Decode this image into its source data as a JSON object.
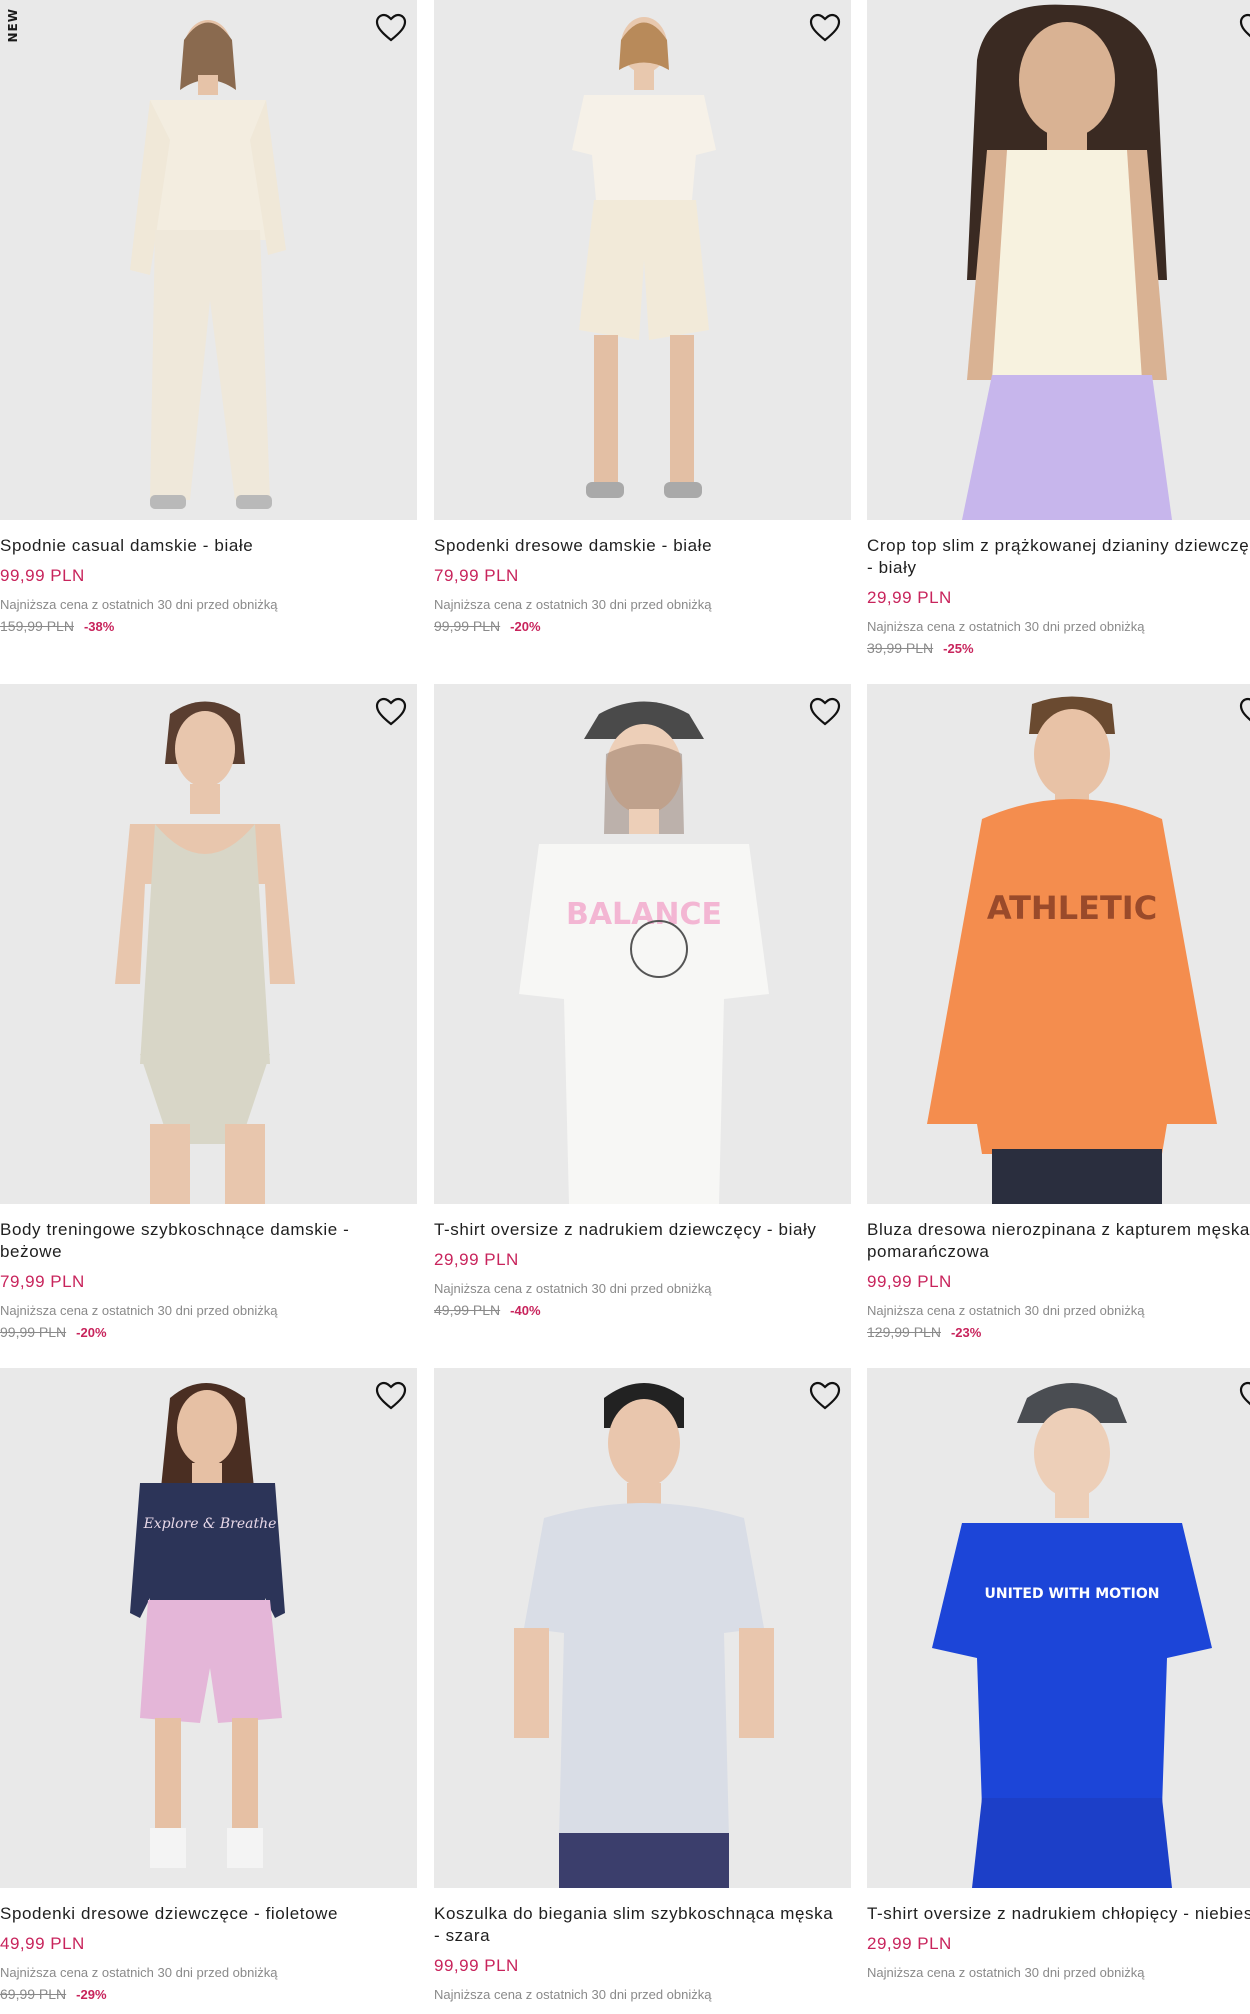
{
  "new_badge": "NEW",
  "products": [
    {
      "title": "Spodnie casual damskie - białe",
      "price": "99,99 PLN",
      "lowest": "Najniższa cena z ostatnich 30 dni przed obniżką",
      "old_price": "159,99 PLN",
      "discount": "-38%",
      "badge": "NEW"
    },
    {
      "title": "Spodenki dresowe damskie - białe",
      "price": "79,99 PLN",
      "lowest": "Najniższa cena z ostatnich 30 dni przed obniżką",
      "old_price": "99,99 PLN",
      "discount": "-20%"
    },
    {
      "title": "Crop top slim z prążkowanej dzianiny dziewczęcy - biały",
      "price": "29,99 PLN",
      "lowest": "Najniższa cena z ostatnich 30 dni przed obniżką",
      "old_price": "39,99 PLN",
      "discount": "-25%"
    },
    {
      "title": "Body treningowe szybkoschnące damskie - beżowe",
      "price": "79,99 PLN",
      "lowest": "Najniższa cena z ostatnich 30 dni przed obniżką",
      "old_price": "99,99 PLN",
      "discount": "-20%"
    },
    {
      "title": "T-shirt oversize z nadrukiem dziewczęcy - biały",
      "price": "29,99 PLN",
      "lowest": "Najniższa cena z ostatnich 30 dni przed obniżką",
      "old_price": "49,99 PLN",
      "discount": "-40%",
      "print": "BALANCE"
    },
    {
      "title": "Bluza dresowa nierozpinana z kapturem męska - pomarańczowa",
      "price": "99,99 PLN",
      "lowest": "Najniższa cena z ostatnich 30 dni przed obniżką",
      "old_price": "129,99 PLN",
      "discount": "-23%",
      "print": "ATHLETIC"
    },
    {
      "title": "Spodenki dresowe dziewczęce - fioletowe",
      "price": "49,99 PLN",
      "lowest": "Najniższa cena z ostatnich 30 dni przed obniżką",
      "old_price": "69,99 PLN",
      "discount": "-29%",
      "print": "Explore & Breathe"
    },
    {
      "title": "Koszulka do biegania slim szybkoschnąca męska - szara",
      "price": "99,99 PLN",
      "lowest": "Najniższa cena z ostatnich 30 dni przed obniżką"
    },
    {
      "title": "T-shirt oversize z nadrukiem chłopięcy - niebieski",
      "price": "29,99 PLN",
      "lowest": "Najniższa cena z ostatnich 30 dni przed obniżką",
      "print": "UNITED WITH MOTION"
    }
  ],
  "colors": {
    "price": "#c8245c",
    "muted": "#8a8a8a",
    "photo_bg": "#e9e9e9"
  },
  "icons": {
    "favorite": "heart-outline-icon"
  }
}
